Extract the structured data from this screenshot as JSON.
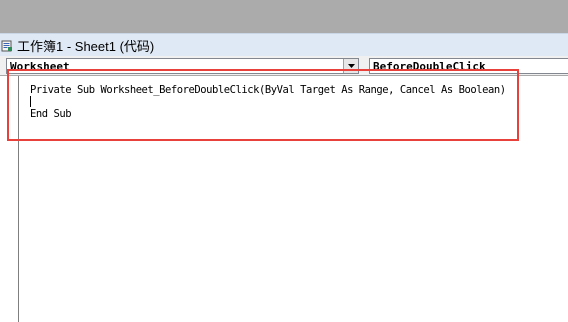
{
  "window": {
    "title": "工作簿1 - Sheet1 (代码)"
  },
  "object_combo": {
    "value": "Worksheet"
  },
  "procedure_combo": {
    "value": "BeforeDoubleClick"
  },
  "code": {
    "lines": [
      "Private Sub Worksheet_BeforeDoubleClick(ByVal Target As Range, Cancel As Boolean)",
      "",
      "End Sub"
    ]
  },
  "colors": {
    "highlight_border": "#e8413b",
    "titlebar_bg": "#dfe9f5"
  },
  "icons": {
    "title": "vba-module-icon",
    "dropdown": "dropdown-arrow-icon"
  }
}
